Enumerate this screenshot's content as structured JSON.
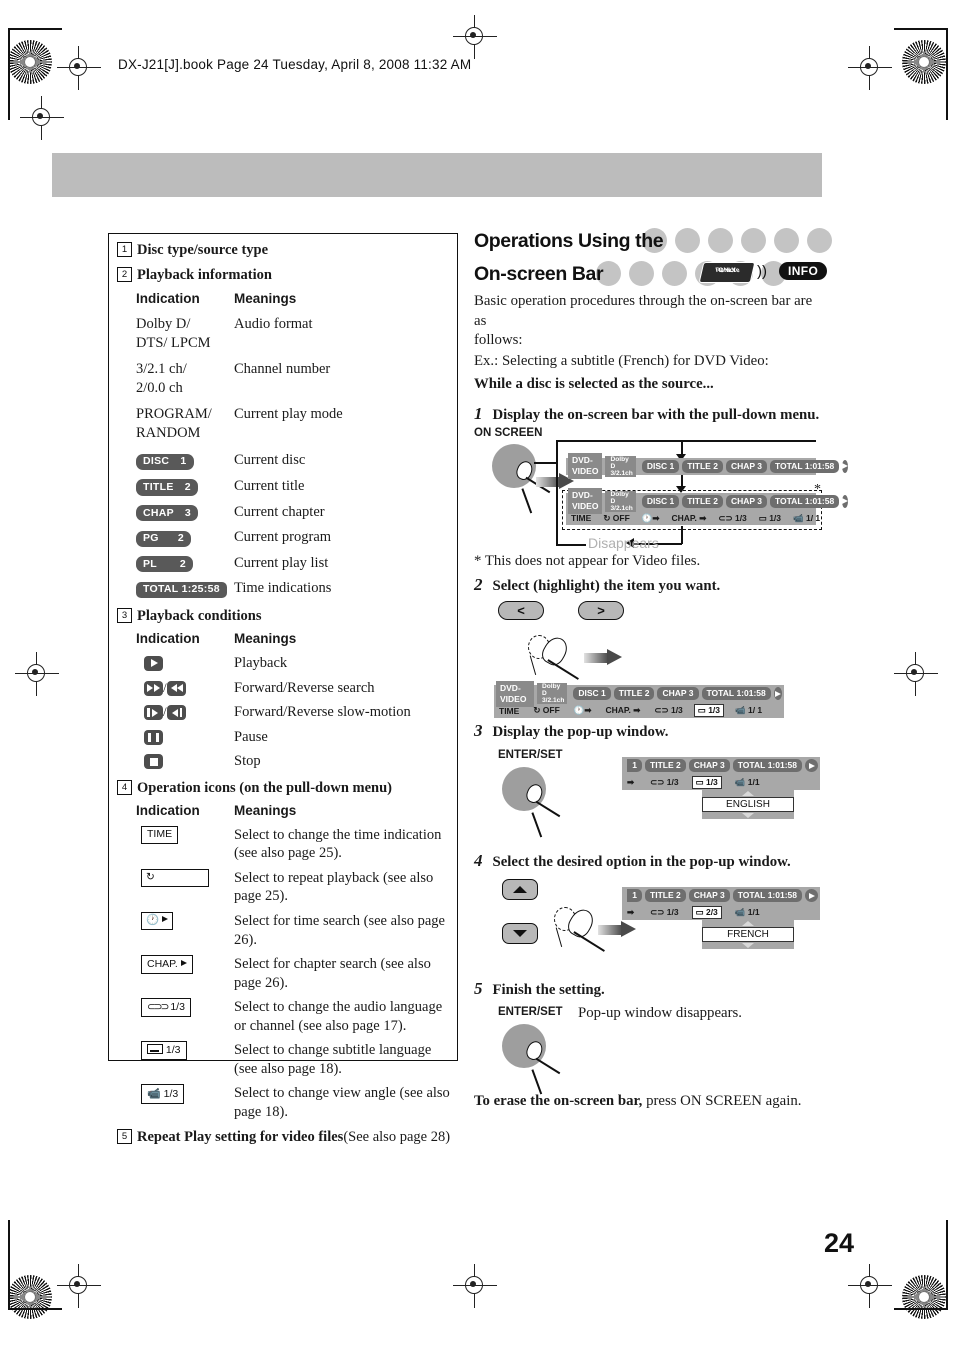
{
  "page_header": "DX-J21[J].book  Page 24  Tuesday, April 8, 2008  11:32 AM",
  "page_number": "24",
  "left_panel": {
    "sections": [
      {
        "num": "1",
        "title": "Disc type/source type"
      },
      {
        "num": "2",
        "title": "Playback information",
        "col_headers": {
          "indication": "Indication",
          "meanings": "Meanings"
        },
        "rows": [
          {
            "indication": "Dolby D/ DTS/ LPCM",
            "indication_line1": "Dolby D/",
            "indication_line2": "DTS/ LPCM",
            "meaning": "Audio format",
            "type": "text"
          },
          {
            "indication": "3/2.1 ch/ 2/0.0 ch",
            "indication_line1": "3/2.1 ch/",
            "indication_line2": "2/0.0 ch",
            "meaning": "Channel number",
            "type": "text"
          },
          {
            "indication": "PROGRAM/ RANDOM",
            "indication_line1": "PROGRAM/",
            "indication_line2": "RANDOM",
            "meaning": "Current play mode",
            "type": "text"
          },
          {
            "indication": "DISC 1",
            "label": "DISC",
            "value": "1",
            "meaning": "Current disc",
            "type": "pill"
          },
          {
            "indication": "TITLE 2",
            "label": "TITLE",
            "value": "2",
            "meaning": "Current title",
            "type": "pill"
          },
          {
            "indication": "CHAP 3",
            "label": "CHAP",
            "value": "3",
            "meaning": "Current chapter",
            "type": "pill"
          },
          {
            "indication": "PG 2",
            "label": "PG",
            "value": "2",
            "meaning": "Current program",
            "type": "pill"
          },
          {
            "indication": "PL 2",
            "label": "PL",
            "value": "2",
            "meaning": "Current play list",
            "type": "pill"
          },
          {
            "indication": "TOTAL 1:25:58",
            "label": "TOTAL",
            "value": "1:25:58",
            "meaning": "Time indications",
            "type": "pill"
          }
        ]
      },
      {
        "num": "3",
        "title": "Playback conditions",
        "col_headers": {
          "indication": "Indication",
          "meanings": "Meanings"
        },
        "rows": [
          {
            "icon": "play-icon",
            "meaning": "Playback"
          },
          {
            "icon": "fast-forward-rewind-icon",
            "meaning": "Forward/Reverse search"
          },
          {
            "icon": "slow-forward-reverse-icon",
            "meaning": "Forward/Reverse slow-motion"
          },
          {
            "icon": "pause-icon",
            "meaning": "Pause"
          },
          {
            "icon": "stop-icon",
            "meaning": "Stop"
          }
        ]
      },
      {
        "num": "4",
        "title": "Operation icons (on the pull-down menu)",
        "col_headers": {
          "indication": "Indication",
          "meanings": "Meanings"
        },
        "rows": [
          {
            "icon_label": "TIME",
            "icon": "time-icon",
            "meaning": "Select to change the time indication (see also page 25)."
          },
          {
            "icon_label": "",
            "icon": "repeat-icon",
            "meaning": "Select to repeat playback (see also page 25)."
          },
          {
            "icon_label": "",
            "icon": "time-search-icon",
            "meaning": "Select for time search (see also page 26)."
          },
          {
            "icon_label": "CHAP.",
            "icon": "chapter-search-icon",
            "meaning": "Select for chapter search (see also page 26)."
          },
          {
            "icon_label": "1/3",
            "icon": "audio-language-icon",
            "meaning": "Select to change the audio language or channel (see also page 17)."
          },
          {
            "icon_label": "1/3",
            "icon": "subtitle-icon",
            "meaning": "Select to change subtitle language (see also page 18)."
          },
          {
            "icon_label": "1/3",
            "icon": "view-angle-icon",
            "meaning": "Select to change view angle (see also page 18)."
          }
        ]
      },
      {
        "num": "5",
        "title": "Repeat Play setting for video files",
        "title_rest": "(See also page 28)"
      }
    ]
  },
  "right_panel": {
    "title_line1": "Operations Using the",
    "title_line2": "On-screen Bar",
    "remote_badge_line1": "Remote",
    "remote_badge_line2": "ONLY",
    "info_button": "INFO",
    "intro_line1": "Basic operation procedures through the on-screen bar are as",
    "intro_line2": "follows:",
    "intro_line3": "Ex.: Selecting a subtitle (French) for DVD Video:",
    "intro_bold": "While a disc is selected as the source...",
    "steps": [
      {
        "num": "1",
        "text": "Display the on-screen bar with the pull-down menu."
      },
      {
        "num": "2",
        "text": "Select (highlight) the item you want."
      },
      {
        "num": "3",
        "text": "Display the pop-up window."
      },
      {
        "num": "4",
        "text": "Select the desired option in the pop-up window."
      },
      {
        "num": "5",
        "text": "Finish the setting."
      }
    ],
    "step1": {
      "button_label": "ON SCREEN",
      "disappears_label": "Disappears",
      "footnote": "* This does not appear for Video files.",
      "asterisk": "*"
    },
    "step2": {
      "key_left": "<",
      "key_right": ">"
    },
    "step3": {
      "button_label": "ENTER/SET",
      "popup_value": "ENGLISH"
    },
    "step4": {
      "popup_value": "FRENCH"
    },
    "step5": {
      "button_label": "ENTER/SET",
      "note": "Pop-up window disappears."
    },
    "closing_bold": "To erase the on-screen bar,",
    "closing_rest": " press ON SCREEN again."
  },
  "osd_bar": {
    "source": "DVD-VIDEO",
    "audio_format": "Dolby D",
    "channels": "3/2.1ch",
    "disc": "DISC 1",
    "title": "TITLE  2",
    "chapter": "CHAP  3",
    "time_label": "TOTAL",
    "time_value": "1:01:58",
    "menu": {
      "time": "TIME",
      "repeat": "OFF",
      "time_search": "",
      "chapter_search": "CHAP.",
      "audio": "1/3",
      "subtitle": "1/3",
      "subtitle_step4": "2/3",
      "angle": "1/ 1",
      "angle_alt": "1/1"
    }
  },
  "colors": {
    "banner": "#bcbcbc",
    "pill": "#595959",
    "osd_background": "#a8a8a8",
    "osd_cell": "#6e6e6e",
    "accent_black": "#111111"
  }
}
